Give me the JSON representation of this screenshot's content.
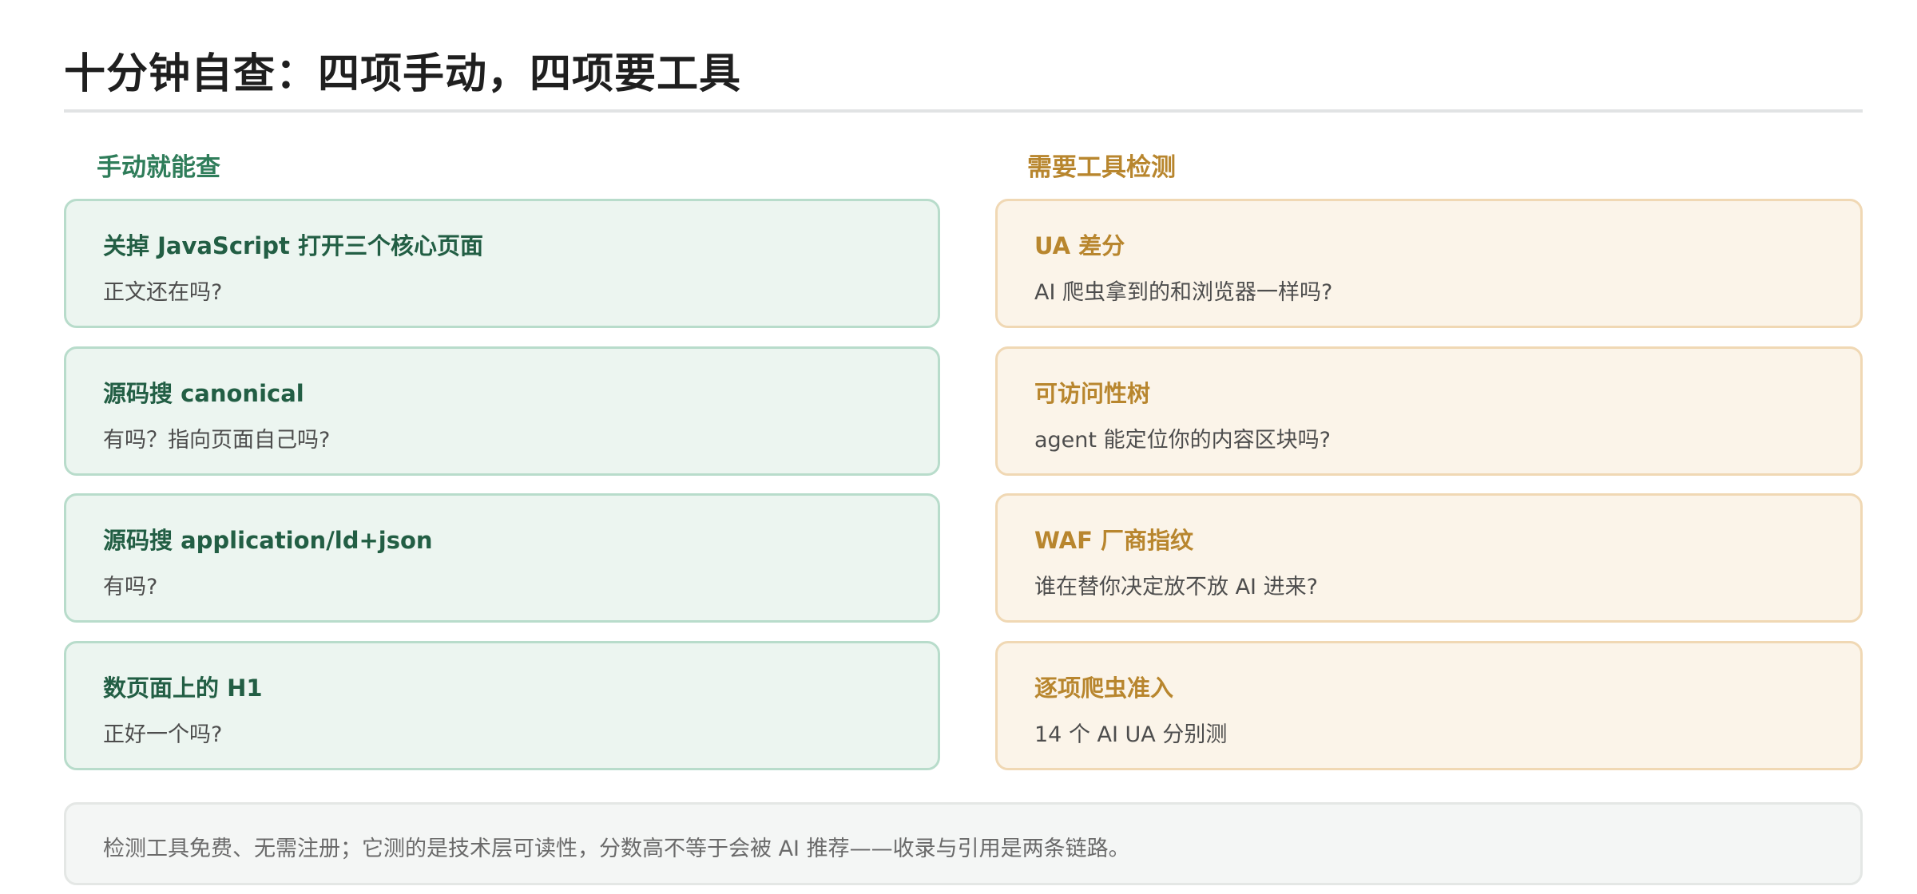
{
  "title": "十分钟自查：四项手动，四项要工具",
  "manual": {
    "header": "手动就能查",
    "items": [
      {
        "title": "关掉 JavaScript 打开三个核心页面",
        "desc": "正文还在吗?"
      },
      {
        "title": "源码搜 canonical",
        "desc": "有吗？指向页面自己吗?"
      },
      {
        "title": "源码搜 application/ld+json",
        "desc": "有吗?"
      },
      {
        "title": "数页面上的 H1",
        "desc": "正好一个吗?"
      }
    ]
  },
  "tools": {
    "header": "需要工具检测",
    "items": [
      {
        "title": "UA 差分",
        "desc": "AI 爬虫拿到的和浏览器一样吗?"
      },
      {
        "title": "可访问性树",
        "desc": "agent 能定位你的内容区块吗?"
      },
      {
        "title": "WAF 厂商指纹",
        "desc": "谁在替你决定放不放 AI 进来?"
      },
      {
        "title": "逐项爬虫准入",
        "desc": "14 个 AI UA 分别测"
      }
    ]
  },
  "footer": {
    "note": "检测工具免费、无需注册；它测的是技术层可读性，分数高不等于会被 AI 推荐——收录与引用是两条链路。"
  },
  "colors": {
    "manual_accent": "#2f7d5a",
    "manual_bg": "#ecf5f0",
    "tools_accent": "#b8862e",
    "tools_bg": "#fbf4e9"
  }
}
